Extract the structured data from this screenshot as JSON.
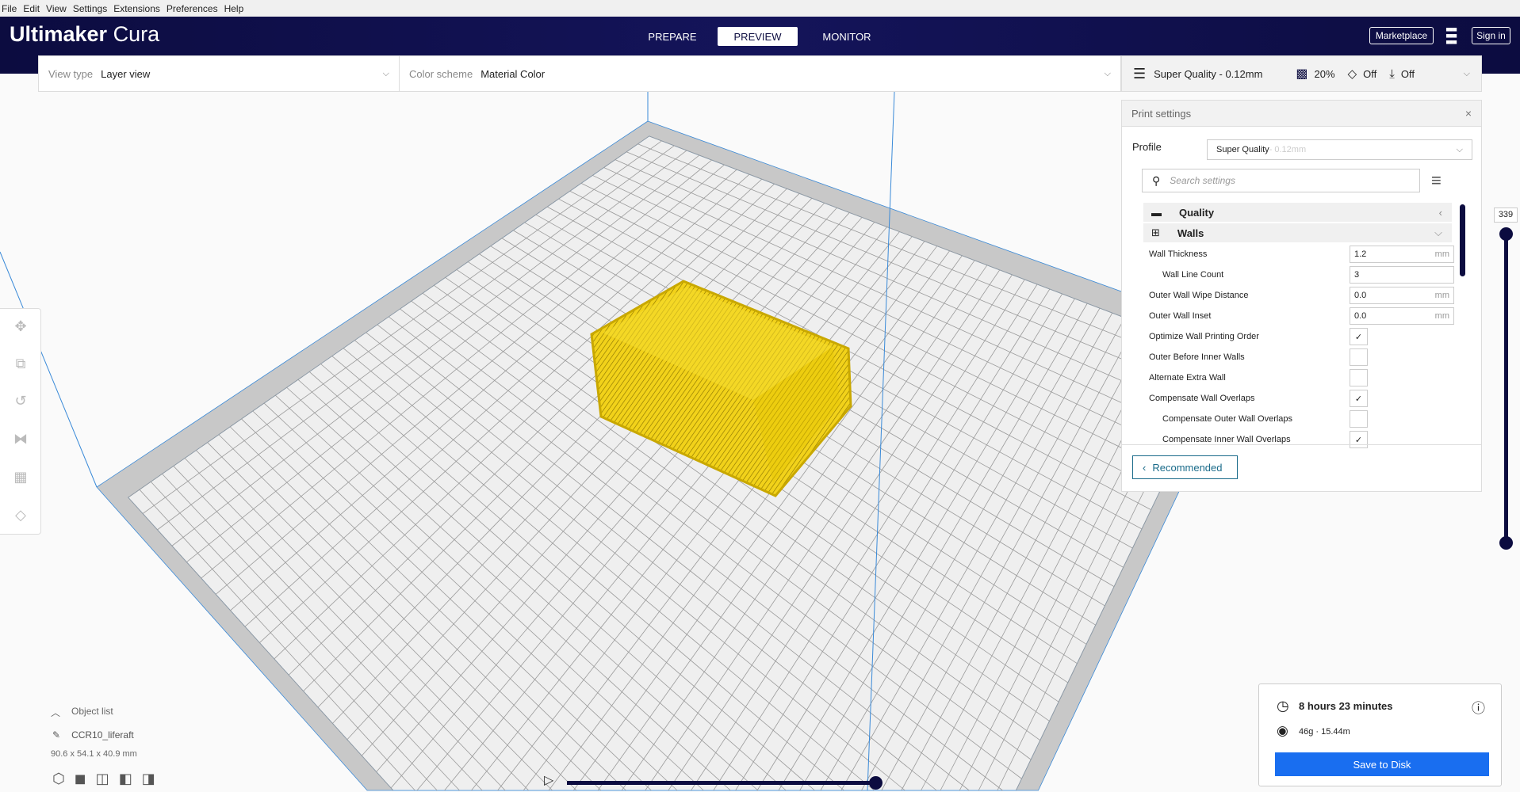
{
  "menu": [
    "File",
    "Edit",
    "View",
    "Settings",
    "Extensions",
    "Preferences",
    "Help"
  ],
  "header": {
    "logo_bold": "Ultimaker",
    "logo_light": "Cura",
    "stages": [
      "PREPARE",
      "PREVIEW",
      "MONITOR"
    ],
    "active_stage": "PREVIEW",
    "marketplace": "Marketplace",
    "sign_in": "Sign in"
  },
  "viewbar": {
    "view_type_label": "View type",
    "view_type_value": "Layer view",
    "color_scheme_label": "Color scheme",
    "color_scheme_value": "Material Color"
  },
  "setbar": {
    "profile": "Super Quality - 0.12mm",
    "infill": "20%",
    "support": "Off",
    "adhesion": "Off"
  },
  "print_settings": {
    "title": "Print settings",
    "profile_label": "Profile",
    "profile_name": "Super Quality",
    "profile_suffix": " - 0.12mm",
    "search_placeholder": "Search settings",
    "categories": [
      "Quality",
      "Walls"
    ],
    "settings": [
      {
        "label": "Wall Thickness",
        "value": "1.2",
        "unit": "mm",
        "type": "num",
        "indent": false
      },
      {
        "label": "Wall Line Count",
        "value": "3",
        "unit": "",
        "type": "num",
        "indent": true
      },
      {
        "label": "Outer Wall Wipe Distance",
        "value": "0.0",
        "unit": "mm",
        "type": "num",
        "indent": false
      },
      {
        "label": "Outer Wall Inset",
        "value": "0.0",
        "unit": "mm",
        "type": "num",
        "indent": false
      },
      {
        "label": "Optimize Wall Printing Order",
        "checked": true,
        "type": "bool",
        "indent": false
      },
      {
        "label": "Outer Before Inner Walls",
        "checked": false,
        "type": "bool",
        "indent": false
      },
      {
        "label": "Alternate Extra Wall",
        "checked": false,
        "type": "bool",
        "indent": false
      },
      {
        "label": "Compensate Wall Overlaps",
        "checked": true,
        "type": "bool",
        "indent": false
      },
      {
        "label": "Compensate Outer Wall Overlaps",
        "checked": false,
        "type": "bool",
        "indent": true
      },
      {
        "label": "Compensate Inner Wall Overlaps",
        "checked": true,
        "type": "bool",
        "indent": true
      }
    ],
    "recommended": "Recommended"
  },
  "layer_slider": {
    "value": "339"
  },
  "object_list": {
    "title": "Object list",
    "object": "CCR10_liferaft",
    "dimensions": "90.6 x 54.1 x 40.9 mm"
  },
  "job": {
    "time": "8 hours 23 minutes",
    "material": "46g · 15.44m",
    "save": "Save to Disk"
  },
  "colors": {
    "header": "#0c0c40",
    "accent": "#196ef0",
    "model": "#f0d000"
  }
}
